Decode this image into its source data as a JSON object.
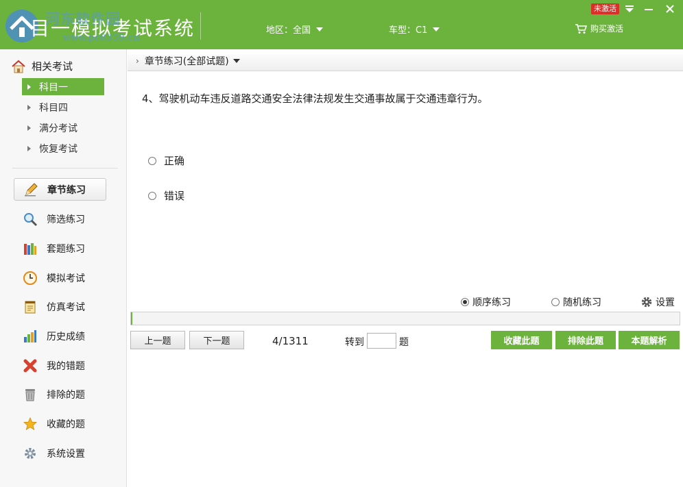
{
  "header": {
    "app_title": "目一模拟考试系统",
    "watermark_text": "河东软件园",
    "watermark_url": "www.pc0359.cn",
    "region_label": "地区：全国",
    "vehicle_label": "车型：C1",
    "buy_label": "购买激活",
    "status_badge": "未激活",
    "accent_color": "#6cb33e"
  },
  "sidebar": {
    "related_title": "相关考试",
    "sub_items": [
      {
        "label": "科目一",
        "active": true
      },
      {
        "label": "科目四",
        "active": false
      },
      {
        "label": "满分考试",
        "active": false
      },
      {
        "label": "恢复考试",
        "active": false
      }
    ],
    "nav_items": [
      {
        "label": "章节练习",
        "icon": "pencil-icon",
        "active": true
      },
      {
        "label": "筛选练习",
        "icon": "magnifier-icon",
        "active": false
      },
      {
        "label": "套题练习",
        "icon": "books-icon",
        "active": false
      },
      {
        "label": "模拟考试",
        "icon": "clock-icon",
        "active": false
      },
      {
        "label": "仿真考试",
        "icon": "notepad-icon",
        "active": false
      },
      {
        "label": "历史成绩",
        "icon": "bar-chart-icon",
        "active": false
      },
      {
        "label": "我的错题",
        "icon": "red-x-icon",
        "active": false
      },
      {
        "label": "排除的题",
        "icon": "trash-icon",
        "active": false
      },
      {
        "label": "收藏的题",
        "icon": "star-icon",
        "active": false
      },
      {
        "label": "系统设置",
        "icon": "gear-icon",
        "active": false
      }
    ]
  },
  "main": {
    "breadcrumb": "章节练习(全部试题)",
    "question_text": "4、驾驶机动车违反道路交通安全法律法规发生交通事故属于交通违章行为。",
    "options": [
      "正确",
      "错误"
    ],
    "mode_sequential": "顺序练习",
    "mode_random": "随机练习",
    "settings_label": "设置",
    "progress_fraction": 0.003,
    "prev_label": "上一题",
    "next_label": "下一题",
    "counter": "4/1311",
    "goto_label": "转到",
    "goto_suffix": "题",
    "goto_value": "",
    "favorite_label": "收藏此题",
    "exclude_label": "排除此题",
    "analysis_label": "本题解析"
  }
}
